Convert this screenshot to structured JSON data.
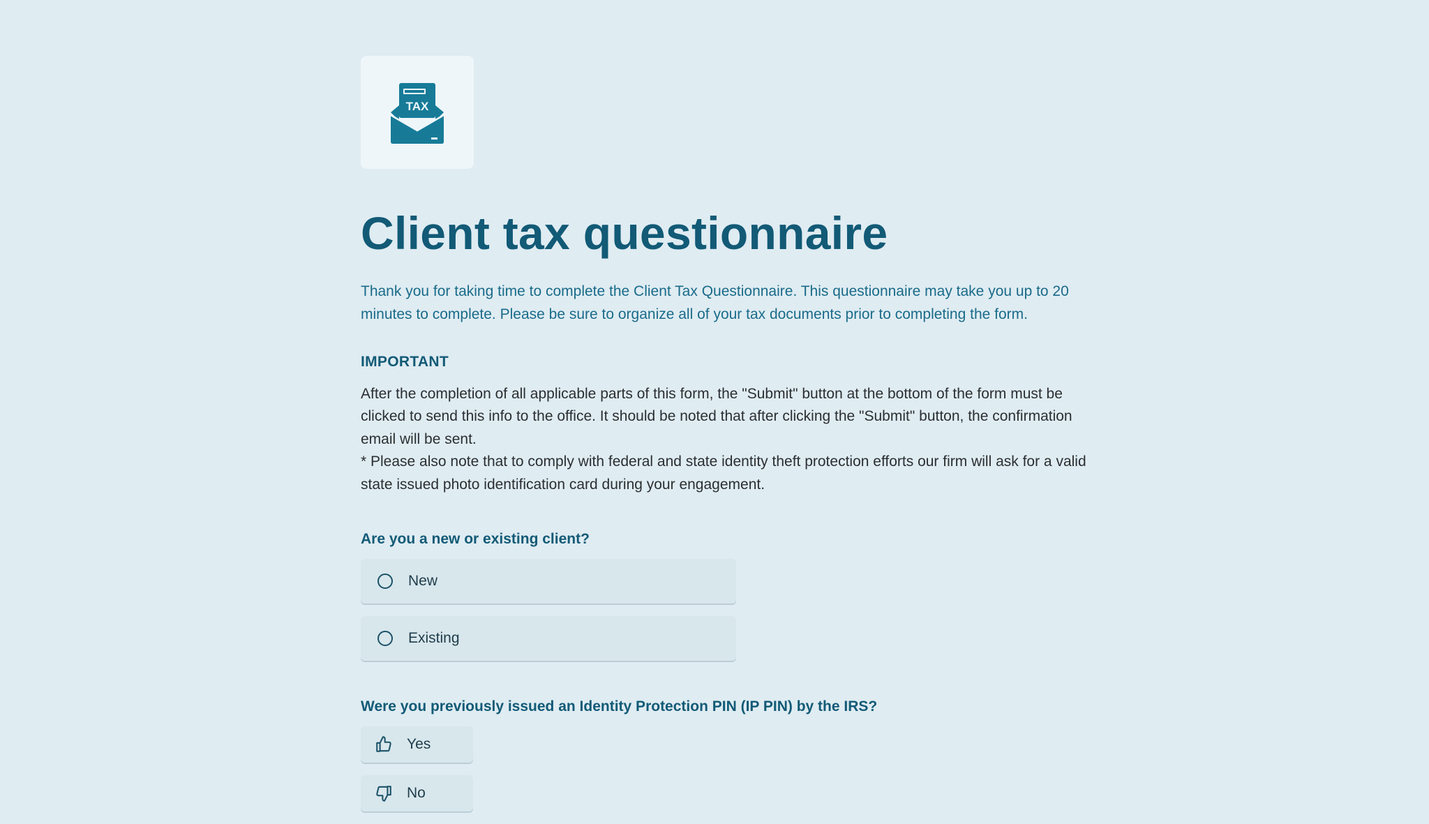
{
  "logo": {
    "icon": "tax-envelope-icon",
    "text": "TAX",
    "color": "#177b98"
  },
  "title": "Client tax questionnaire",
  "intro": "Thank you for taking time to complete the Client Tax Questionnaire. This questionnaire may take you up to 20 minutes to complete. Please be sure to organize all of your tax documents prior to completing the form.",
  "important": {
    "heading": "IMPORTANT",
    "paragraph1": "After the completion of all applicable parts of this form, the \"Submit\" button at the bottom of the form must be clicked to send this info to the office. It should be noted that after clicking the \"Submit\" button, the confirmation email will be sent.",
    "paragraph2": "* Please also note that to comply with federal and state identity theft protection efforts our firm will ask for a valid state issued photo identification card during your engagement."
  },
  "question1": {
    "label": "Are you a new or existing client?",
    "options": [
      {
        "label": "New",
        "selected": false
      },
      {
        "label": "Existing",
        "selected": false
      }
    ]
  },
  "question2": {
    "label": "Were you previously issued an Identity Protection PIN (IP PIN) by the IRS?",
    "options": [
      {
        "label": "Yes",
        "icon": "thumbs-up-icon"
      },
      {
        "label": "No",
        "icon": "thumbs-down-icon"
      }
    ]
  },
  "colors": {
    "background": "#dfecf2",
    "heading": "#125a76",
    "intro_text": "#1a6b89",
    "body_text": "#2b2f33",
    "option_bg": "#d8e7ec"
  }
}
